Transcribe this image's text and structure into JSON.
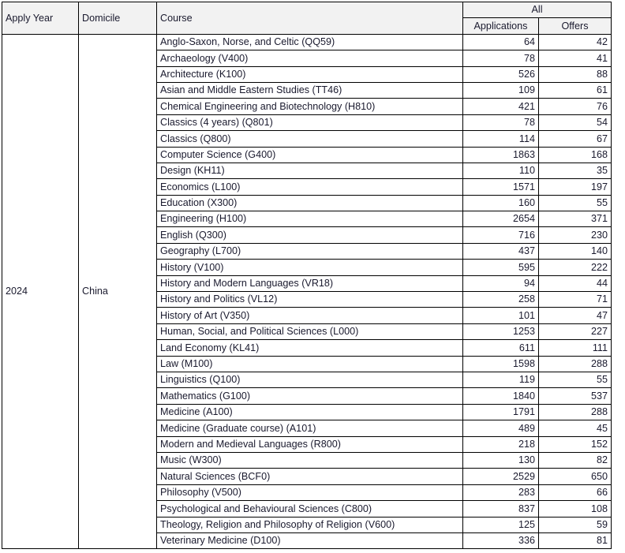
{
  "table": {
    "headers": {
      "apply_year": "Apply Year",
      "domicile": "Domicile",
      "course": "Course",
      "group_all": "All",
      "applications": "Applications",
      "offers": "Offers"
    },
    "apply_year": "2024",
    "domicile": "China",
    "rows": [
      {
        "course": "Anglo-Saxon, Norse, and Celtic (QQ59)",
        "applications": "64",
        "offers": "42"
      },
      {
        "course": "Archaeology (V400)",
        "applications": "78",
        "offers": "41"
      },
      {
        "course": "Architecture (K100)",
        "applications": "526",
        "offers": "88"
      },
      {
        "course": "Asian and Middle Eastern Studies (TT46)",
        "applications": "109",
        "offers": "61"
      },
      {
        "course": "Chemical Engineering and Biotechnology (H810)",
        "applications": "421",
        "offers": "76"
      },
      {
        "course": "Classics (4 years) (Q801)",
        "applications": "78",
        "offers": "54"
      },
      {
        "course": "Classics (Q800)",
        "applications": "114",
        "offers": "67"
      },
      {
        "course": "Computer Science (G400)",
        "applications": "1863",
        "offers": "168"
      },
      {
        "course": "Design (KH11)",
        "applications": "110",
        "offers": "35"
      },
      {
        "course": "Economics (L100)",
        "applications": "1571",
        "offers": "197"
      },
      {
        "course": "Education (X300)",
        "applications": "160",
        "offers": "55"
      },
      {
        "course": "Engineering (H100)",
        "applications": "2654",
        "offers": "371"
      },
      {
        "course": "English (Q300)",
        "applications": "716",
        "offers": "230"
      },
      {
        "course": "Geography (L700)",
        "applications": "437",
        "offers": "140"
      },
      {
        "course": "History (V100)",
        "applications": "595",
        "offers": "222"
      },
      {
        "course": "History and Modern Languages (VR18)",
        "applications": "94",
        "offers": "44"
      },
      {
        "course": "History and Politics (VL12)",
        "applications": "258",
        "offers": "71"
      },
      {
        "course": "History of Art (V350)",
        "applications": "101",
        "offers": "47"
      },
      {
        "course": "Human, Social, and Political Sciences (L000)",
        "applications": "1253",
        "offers": "227"
      },
      {
        "course": "Land Economy (KL41)",
        "applications": "611",
        "offers": "111"
      },
      {
        "course": "Law (M100)",
        "applications": "1598",
        "offers": "288"
      },
      {
        "course": "Linguistics (Q100)",
        "applications": "119",
        "offers": "55"
      },
      {
        "course": "Mathematics (G100)",
        "applications": "1840",
        "offers": "537"
      },
      {
        "course": "Medicine (A100)",
        "applications": "1791",
        "offers": "288"
      },
      {
        "course": "Medicine (Graduate course) (A101)",
        "applications": "489",
        "offers": "45"
      },
      {
        "course": "Modern and Medieval Languages (R800)",
        "applications": "218",
        "offers": "152"
      },
      {
        "course": "Music (W300)",
        "applications": "130",
        "offers": "82"
      },
      {
        "course": "Natural Sciences (BCF0)",
        "applications": "2529",
        "offers": "650"
      },
      {
        "course": "Philosophy (V500)",
        "applications": "283",
        "offers": "66"
      },
      {
        "course": "Psychological and Behavioural Sciences (C800)",
        "applications": "837",
        "offers": "108"
      },
      {
        "course": "Theology, Religion and Philosophy of Religion (V600)",
        "applications": "125",
        "offers": "59"
      },
      {
        "course": "Veterinary Medicine (D100)",
        "applications": "336",
        "offers": "81"
      }
    ]
  }
}
